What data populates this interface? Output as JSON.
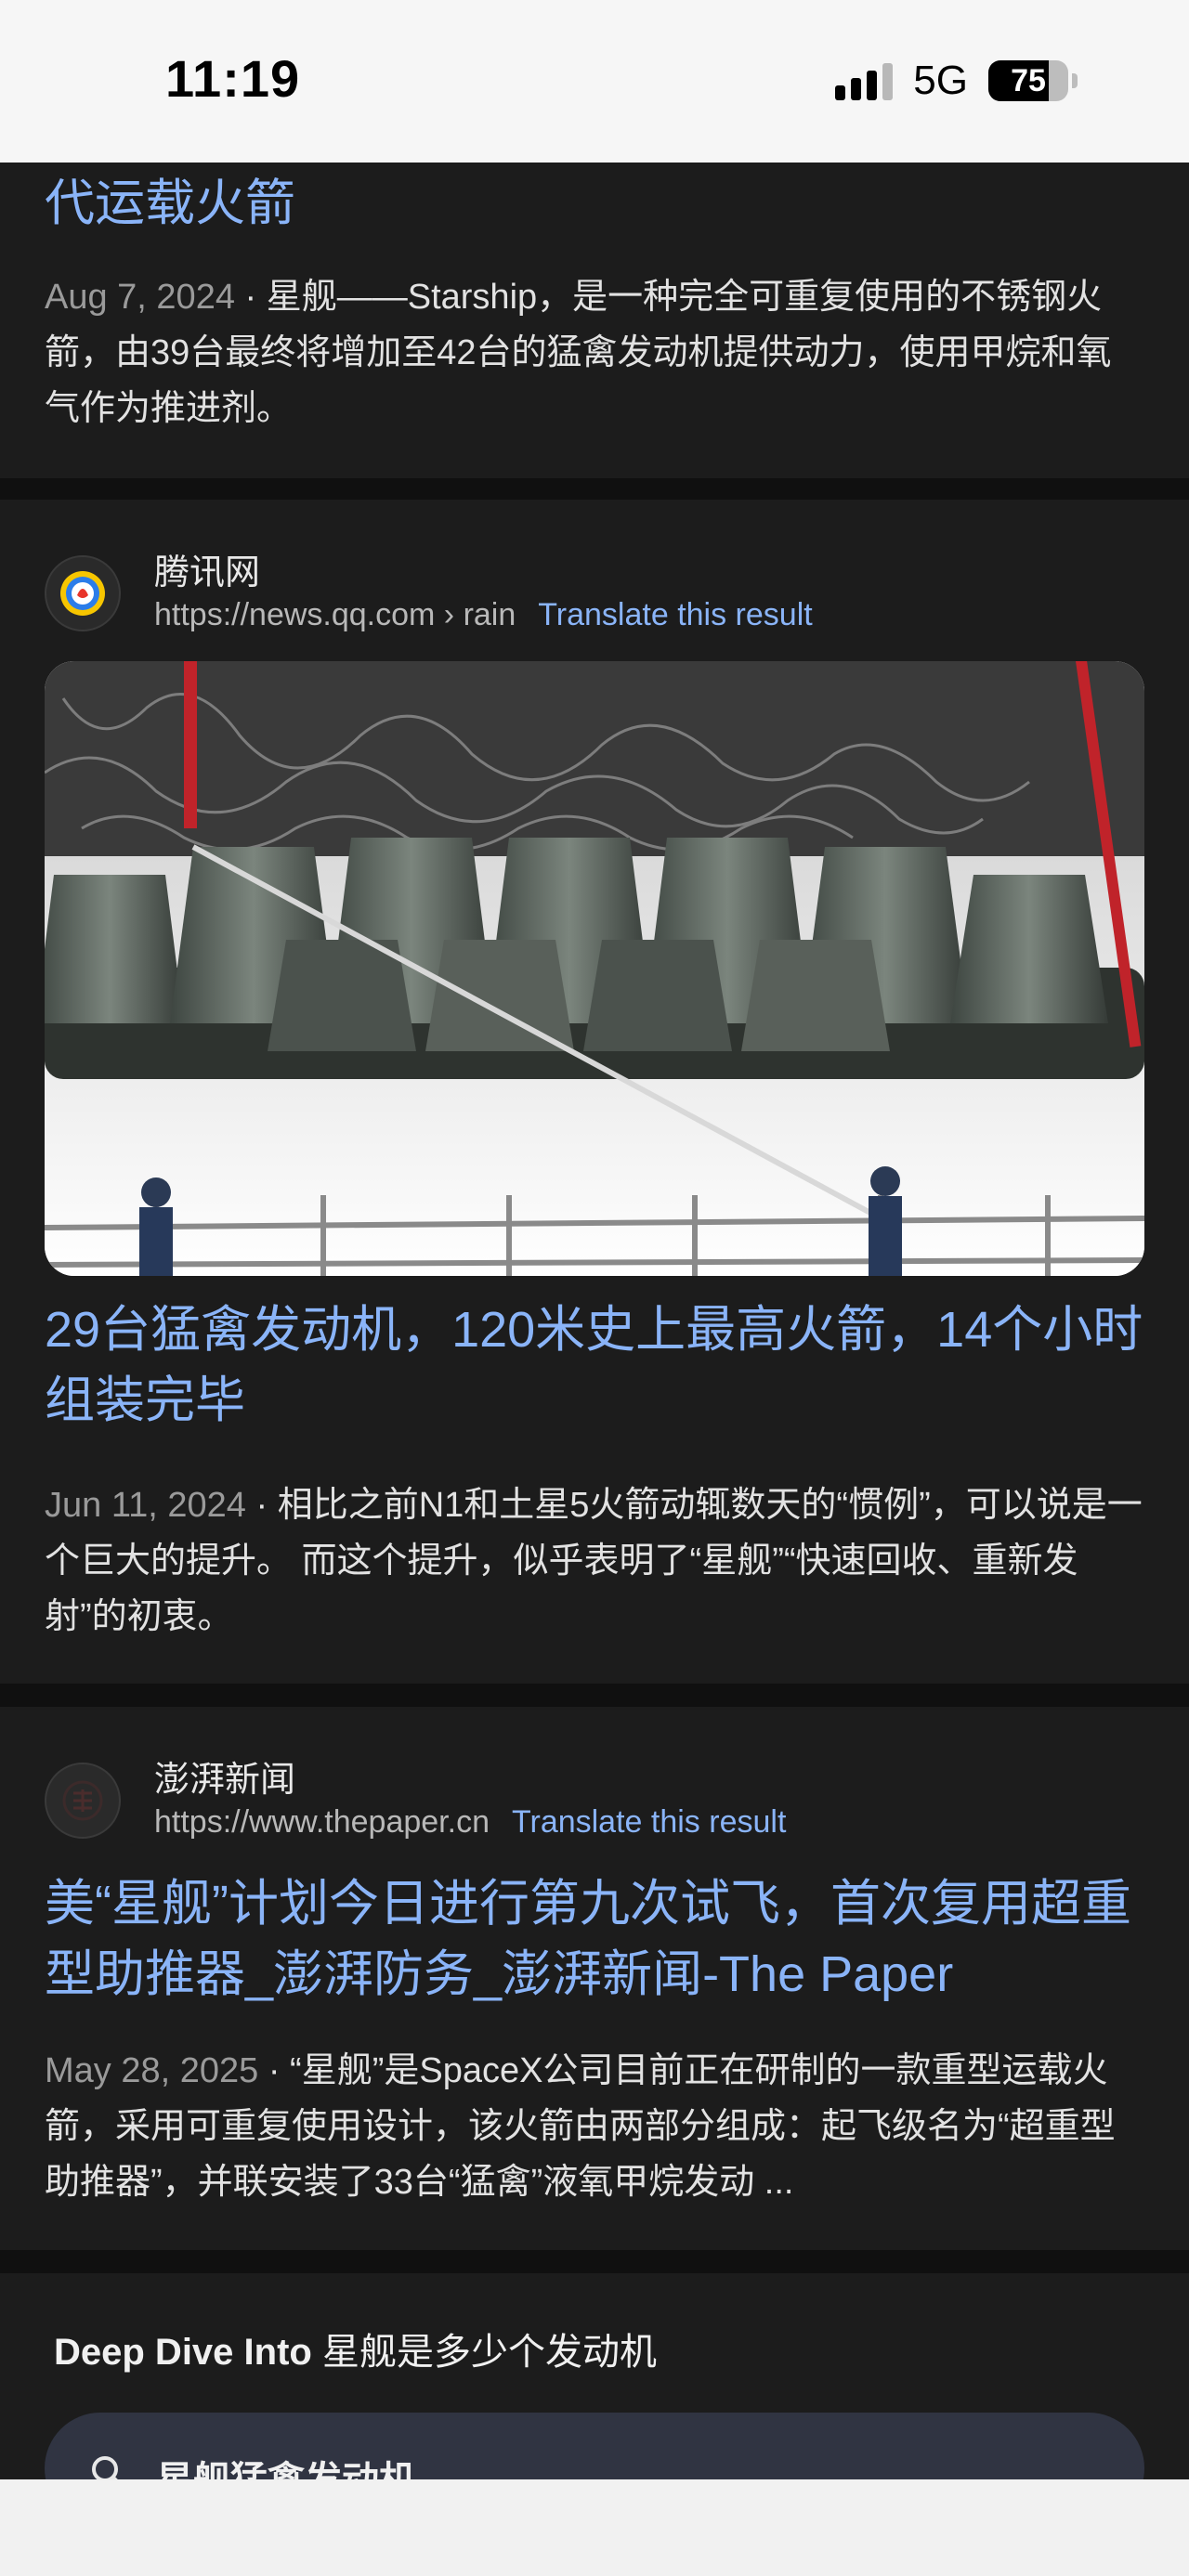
{
  "status_bar": {
    "time": "11:19",
    "network": "5G",
    "battery": "75",
    "battery_level": 0.75
  },
  "results": [
    {
      "title_tail": "代运载火箭",
      "date": "Aug 7, 2024",
      "snippet": " · 星舰——Starship，是一种完全可重复使用的不锈钢火箭，由39台最终将增加至42台的猛禽发动机提供动力，使用甲烷和氧气作为推进剂。"
    },
    {
      "site_name": "腾讯网",
      "url": "https://news.qq.com › rain",
      "translate": "Translate this result",
      "title": "29台猛禽发动机，120米史上最高火箭，14个小时组装完毕",
      "date": "Jun 11, 2024",
      "snippet": " · 相比之前N1和土星5火箭动辄数天的“惯例”，可以说是一个巨大的提升。 而这个提升，似乎表明了“星舰”“快速回收、重新发射”的初衷。"
    },
    {
      "site_name": "澎湃新闻",
      "url": "https://www.thepaper.cn",
      "translate": "Translate this result",
      "title": "美“星舰”计划今日进行第九次试飞，首次复用超重型助推器_澎湃防务_澎湃新闻-The Paper",
      "date": "May 28, 2025",
      "snippet": " · “星舰”是SpaceX公司目前正在研制的一款重型运载火箭，采用可重复使用设计，该火箭由两部分组成：起飞级名为“超重型助推器”，并联安装了33台“猛禽”液氧甲烷发动 ..."
    }
  ],
  "deep_dive": {
    "prefix": "Deep Dive Into",
    "query": " 星舰是多少个发动机",
    "suggestion": "星舰猛禽发动机"
  },
  "colors": {
    "link": "#8ab4f8",
    "card": "#1c1c1c",
    "background": "#101010"
  }
}
